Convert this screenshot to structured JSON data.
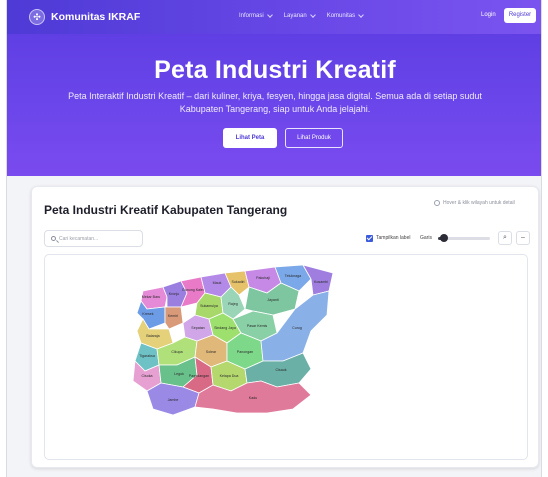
{
  "nav": {
    "brand": "Komunitas IKRAF",
    "menu": [
      "Informasi",
      "Layanan",
      "Komunitas"
    ],
    "login": "Login",
    "register": "Register"
  },
  "hero": {
    "title": "Peta Industri Kreatif",
    "subtitle_line1": "Peta Interaktif Industri Kreatif – dari kuliner, kriya, fesyen, hingga jasa digital. Semua ada di setiap sudut",
    "subtitle_line2": "Kabupaten Tangerang, siap untuk Anda jelajahi.",
    "btn_peta": "Lihat Peta",
    "btn_produk": "Lihat Produk"
  },
  "map_card": {
    "title": "Peta Industri Kreatif Kabupaten Tangerang",
    "hint": "Hover & klik wilayah untuk detail",
    "search_placeholder": "Cari kecamatan...",
    "show_labels": "Tampilkan label",
    "show_labels_checked": true,
    "line_label": "Garis",
    "line_level": 0.12
  },
  "regions": [
    {
      "name": "Mekar Baru",
      "color": "#e58ad6"
    },
    {
      "name": "Kronjo",
      "color": "#9a7fe0"
    },
    {
      "name": "Kresek",
      "color": "#6d9ce6"
    },
    {
      "name": "Gunung Kaler",
      "color": "#e87ac8"
    },
    {
      "name": "Mauk",
      "color": "#b48ae8"
    },
    {
      "name": "Sukadiri",
      "color": "#e6c36a"
    },
    {
      "name": "Kemiri",
      "color": "#d99a7a"
    },
    {
      "name": "Sukamulya",
      "color": "#a8d86a"
    },
    {
      "name": "Rajeg",
      "color": "#9ad5b8"
    },
    {
      "name": "Pakuhaji",
      "color": "#c68ae6"
    },
    {
      "name": "Teluknaga",
      "color": "#7aa8e8"
    },
    {
      "name": "Kosambi",
      "color": "#a07ee0"
    },
    {
      "name": "Jayanti",
      "color": "#7ec6a0"
    },
    {
      "name": "Balaraja",
      "color": "#e4d17a"
    },
    {
      "name": "Sepatan",
      "color": "#d0a6e8"
    },
    {
      "name": "Sindang Jaya",
      "color": "#9ee06e"
    },
    {
      "name": "Tigaraksa",
      "color": "#6ec2c6"
    },
    {
      "name": "Cikupa",
      "color": "#b0e07a"
    },
    {
      "name": "Pasar Kemis",
      "color": "#8ad0a6"
    },
    {
      "name": "Solear",
      "color": "#e0b97a"
    },
    {
      "name": "Panongan",
      "color": "#7ed88a"
    },
    {
      "name": "Curug",
      "color": "#8ab0e8"
    },
    {
      "name": "Cisoka",
      "color": "#e6a0d2"
    },
    {
      "name": "Legok",
      "color": "#68c08a"
    },
    {
      "name": "Pagedangan",
      "color": "#d86a86"
    },
    {
      "name": "Kelapa Dua",
      "color": "#b4d86e"
    },
    {
      "name": "Cisauk",
      "color": "#6ab0a6"
    },
    {
      "name": "Jambe",
      "color": "#9a8ae6"
    },
    {
      "name": "Kadu",
      "color": "#e07a9a"
    }
  ]
}
